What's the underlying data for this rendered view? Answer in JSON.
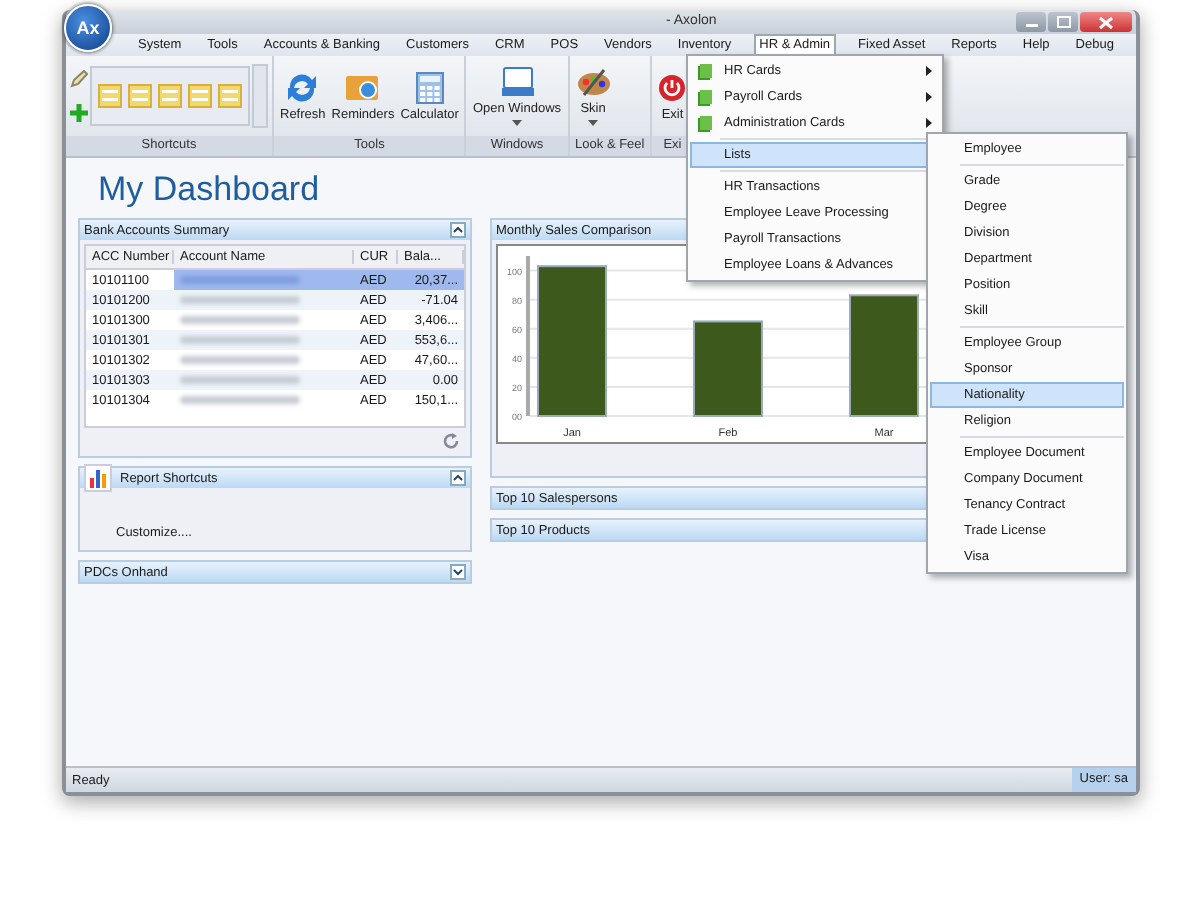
{
  "window": {
    "title": "- Axolon",
    "logo": "Ax"
  },
  "menu_bar": [
    {
      "label": "System",
      "selected": false
    },
    {
      "label": "Tools",
      "selected": false
    },
    {
      "label": "Accounts & Banking",
      "selected": false
    },
    {
      "label": "Customers",
      "selected": false
    },
    {
      "label": "CRM",
      "selected": false
    },
    {
      "label": "POS",
      "selected": false
    },
    {
      "label": "Vendors",
      "selected": false
    },
    {
      "label": "Inventory",
      "selected": false
    },
    {
      "label": "HR & Admin",
      "selected": true
    },
    {
      "label": "Fixed Asset",
      "selected": false
    },
    {
      "label": "Reports",
      "selected": false
    },
    {
      "label": "Help",
      "selected": false
    },
    {
      "label": "Debug",
      "selected": false
    }
  ],
  "ribbon": [
    {
      "label": "Shortcuts",
      "kind": "gallery"
    },
    {
      "label": "Tools",
      "kind": "buttons",
      "buttons": [
        {
          "label": "Refresh",
          "kind": "refresh"
        },
        {
          "label": "Reminders",
          "kind": "reminders"
        },
        {
          "label": "Calculator",
          "kind": "calculator"
        }
      ]
    },
    {
      "label": "Windows",
      "kind": "buttons",
      "buttons": [
        {
          "label": "Open Windows",
          "kind": "windows"
        }
      ]
    },
    {
      "label": "Look & Feel",
      "kind": "buttons",
      "buttons": [
        {
          "label": "Skin",
          "kind": "skin"
        }
      ]
    },
    {
      "label": "Exi",
      "kind": "buttons",
      "buttons": [
        {
          "label": "Exit",
          "kind": "exit"
        }
      ]
    }
  ],
  "hr_admin_menu": [
    [
      {
        "label": "HR Cards",
        "kind": "card",
        "selected": false
      },
      {
        "label": "Payroll Cards",
        "kind": "card",
        "selected": false
      },
      {
        "label": "Administration Cards",
        "kind": "card",
        "selected": false
      }
    ],
    [
      {
        "label": "Lists",
        "kind": "plain",
        "selected": true
      }
    ],
    [
      {
        "label": "HR Transactions",
        "kind": "plain",
        "selected": false
      },
      {
        "label": "Employee Leave Processing",
        "kind": "plain",
        "selected": false
      },
      {
        "label": "Payroll Transactions",
        "kind": "plain",
        "selected": false
      },
      {
        "label": "Employee Loans & Advances",
        "kind": "plain",
        "selected": false
      }
    ]
  ],
  "lists_submenu": [
    [
      {
        "label": "Employee",
        "selected": false
      }
    ],
    [
      {
        "label": "Grade",
        "selected": false
      },
      {
        "label": "Degree",
        "selected": false
      },
      {
        "label": "Division",
        "selected": false
      },
      {
        "label": "Department",
        "selected": false
      },
      {
        "label": "Position",
        "selected": false
      },
      {
        "label": "Skill",
        "selected": false
      }
    ],
    [
      {
        "label": "Employee Group",
        "selected": false
      },
      {
        "label": "Sponsor",
        "selected": false
      },
      {
        "label": "Nationality",
        "selected": true
      },
      {
        "label": "Religion",
        "selected": false
      }
    ],
    [
      {
        "label": "Employee Document",
        "selected": false
      },
      {
        "label": "Company Document",
        "selected": false
      },
      {
        "label": "Tenancy Contract",
        "selected": false
      },
      {
        "label": "Trade License",
        "selected": false
      },
      {
        "label": "Visa",
        "selected": false
      }
    ]
  ],
  "dashboard_title": "My Dashboard",
  "left_panels": [
    {
      "title": "Bank Accounts Summary",
      "kind": "table",
      "expanded": true,
      "table": {
        "columns": [
          "ACC Number",
          "Account Name",
          "CUR",
          "Bala..."
        ],
        "rows": [
          {
            "acc": "10101100",
            "cur": "AED",
            "balance": "20,37...",
            "selected": true
          },
          {
            "acc": "10101200",
            "cur": "AED",
            "balance": "-71.04",
            "selected": false
          },
          {
            "acc": "10101300",
            "cur": "AED",
            "balance": "3,406...",
            "selected": false
          },
          {
            "acc": "10101301",
            "cur": "AED",
            "balance": "553,6...",
            "selected": false
          },
          {
            "acc": "10101302",
            "cur": "AED",
            "balance": "47,60...",
            "selected": false
          },
          {
            "acc": "10101303",
            "cur": "AED",
            "balance": "0.00",
            "selected": false
          },
          {
            "acc": "10101304",
            "cur": "AED",
            "balance": "150,1...",
            "selected": false
          }
        ]
      }
    },
    {
      "title": "Report Shortcuts",
      "kind": "links",
      "expanded": true,
      "links": [
        "Customize...."
      ]
    },
    {
      "title": "PDCs Onhand",
      "kind": "empty",
      "expanded": false
    }
  ],
  "right_panels": [
    {
      "title": "Monthly Sales Comparison",
      "kind": "chart",
      "expanded": true,
      "chart_data": {
        "type": "bar",
        "categories": [
          "Jan",
          "Feb",
          "Mar"
        ],
        "values": [
          103,
          65,
          83
        ],
        "ylim": [
          0,
          110
        ],
        "yticks": [
          {
            "value": 0,
            "label": "00"
          },
          20,
          40,
          60,
          80,
          100
        ],
        "grid": true
      }
    },
    {
      "title": "Top 10 Salespersons",
      "kind": "empty"
    },
    {
      "title": "Top 10 Products",
      "kind": "empty"
    }
  ],
  "status_bar": {
    "message": "Ready",
    "user": "User: sa"
  }
}
